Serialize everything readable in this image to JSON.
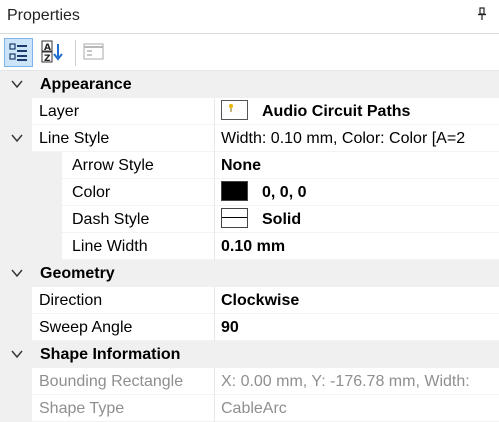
{
  "panel": {
    "title": "Properties",
    "pin_icon": "pin-icon"
  },
  "toolbar": {
    "categorized_icon": "categorized-view-icon",
    "alphabetical_icon": "alphabetical-sort-icon",
    "property_pages_icon": "property-pages-icon"
  },
  "categories": [
    {
      "name": "Appearance",
      "rows": [
        {
          "name": "Layer",
          "value": "Audio Circuit Paths",
          "bold": true,
          "swatch": "layer"
        },
        {
          "name": "Line Style",
          "value": "Width: 0.10 mm, Color: Color [A=2",
          "bold": false,
          "expandable": true
        },
        {
          "name": "Arrow Style",
          "value": "None",
          "bold": true,
          "sub": true
        },
        {
          "name": "Color",
          "value": "0, 0, 0",
          "bold": true,
          "sub": true,
          "swatch": "black"
        },
        {
          "name": "Dash Style",
          "value": "Solid",
          "bold": true,
          "sub": true,
          "swatch": "dash"
        },
        {
          "name": "Line Width",
          "value": "0.10 mm",
          "bold": true,
          "sub": true
        }
      ]
    },
    {
      "name": "Geometry",
      "rows": [
        {
          "name": "Direction",
          "value": "Clockwise",
          "bold": true
        },
        {
          "name": "Sweep Angle",
          "value": "90",
          "bold": true
        }
      ]
    },
    {
      "name": "Shape Information",
      "rows": [
        {
          "name": "Bounding Rectangle",
          "value": "X: 0.00 mm, Y: -176.78 mm, Width:",
          "muted": true
        },
        {
          "name": "Shape Type",
          "value": "CableArc",
          "muted": true
        }
      ]
    }
  ],
  "colors": {
    "selected_tool_bg": "#cce4f7",
    "gutter": "#f0f0f0",
    "muted_text": "#8f8f8f"
  }
}
